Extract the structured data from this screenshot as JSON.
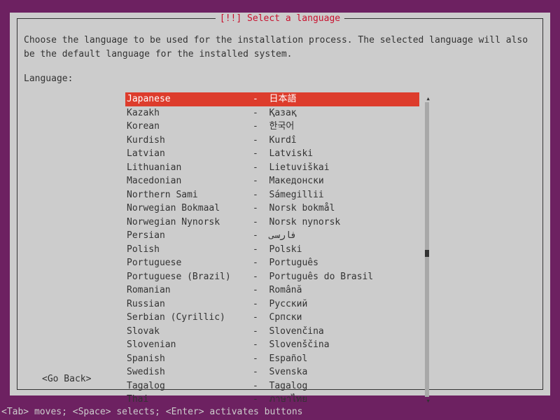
{
  "dialog": {
    "title": "[!!] Select a language",
    "instructions": "Choose the language to be used for the installation process. The selected language will also be the default language for the installed system.",
    "field_label": "Language:",
    "go_back": "<Go Back>"
  },
  "languages": [
    {
      "english": "Japanese",
      "native": "日本語",
      "selected": true
    },
    {
      "english": "Kazakh",
      "native": "Қазақ",
      "selected": false
    },
    {
      "english": "Korean",
      "native": "한국어",
      "selected": false
    },
    {
      "english": "Kurdish",
      "native": "Kurdî",
      "selected": false
    },
    {
      "english": "Latvian",
      "native": "Latviski",
      "selected": false
    },
    {
      "english": "Lithuanian",
      "native": "Lietuviškai",
      "selected": false
    },
    {
      "english": "Macedonian",
      "native": "Македонски",
      "selected": false
    },
    {
      "english": "Northern Sami",
      "native": "Sámegillii",
      "selected": false
    },
    {
      "english": "Norwegian Bokmaal",
      "native": "Norsk bokmål",
      "selected": false
    },
    {
      "english": "Norwegian Nynorsk",
      "native": "Norsk nynorsk",
      "selected": false
    },
    {
      "english": "Persian",
      "native": "فارسی",
      "selected": false
    },
    {
      "english": "Polish",
      "native": "Polski",
      "selected": false
    },
    {
      "english": "Portuguese",
      "native": "Português",
      "selected": false
    },
    {
      "english": "Portuguese (Brazil)",
      "native": "Português do Brasil",
      "selected": false
    },
    {
      "english": "Romanian",
      "native": "Română",
      "selected": false
    },
    {
      "english": "Russian",
      "native": "Русский",
      "selected": false
    },
    {
      "english": "Serbian (Cyrillic)",
      "native": "Српски",
      "selected": false
    },
    {
      "english": "Slovak",
      "native": "Slovenčina",
      "selected": false
    },
    {
      "english": "Slovenian",
      "native": "Slovenščina",
      "selected": false
    },
    {
      "english": "Spanish",
      "native": "Español",
      "selected": false
    },
    {
      "english": "Swedish",
      "native": "Svenska",
      "selected": false
    },
    {
      "english": "Tagalog",
      "native": "Tagalog",
      "selected": false
    },
    {
      "english": "Thai",
      "native": "ภาษาไทย",
      "selected": false
    }
  ],
  "footer": {
    "hint": "<Tab> moves; <Space> selects; <Enter> activates buttons"
  }
}
